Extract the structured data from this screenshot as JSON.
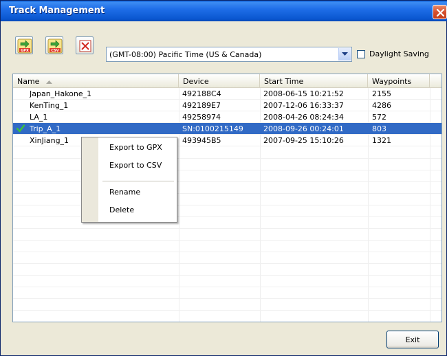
{
  "window": {
    "title": "Track Management",
    "close_icon": "close-icon"
  },
  "toolbar": {
    "export_gpx_label": "GPX",
    "export_csv_label": "CSV",
    "delete_icon": "delete-x-icon"
  },
  "timezone": {
    "selected": "(GMT-08:00) Pacific Time (US & Canada)"
  },
  "daylight_saving": {
    "label": "Daylight Saving",
    "checked": false
  },
  "list": {
    "columns": [
      "Name",
      "Device",
      "Start Time",
      "Waypoints"
    ],
    "sort_column": "Name",
    "sort_direction": "ascending",
    "rows": [
      {
        "name": "Japan_Hakone_1",
        "device": "492188C4",
        "start_time": "2008-06-15 10:21:52",
        "waypoints": "2155",
        "checked": false,
        "selected": false
      },
      {
        "name": "KenTing_1",
        "device": "492189E7",
        "start_time": "2007-12-06 16:33:37",
        "waypoints": "4286",
        "checked": false,
        "selected": false
      },
      {
        "name": "LA_1",
        "device": "49258974",
        "start_time": "2008-04-26 08:24:34",
        "waypoints": "572",
        "checked": false,
        "selected": false
      },
      {
        "name": "Trip_A_1",
        "device": "SN:0100215149",
        "start_time": "2008-09-26 00:24:01",
        "waypoints": "803",
        "checked": true,
        "selected": true
      },
      {
        "name": "XinJiang_1",
        "device": "493945B5",
        "start_time": "2007-09-25 15:10:26",
        "waypoints": "1321",
        "checked": false,
        "selected": false
      }
    ]
  },
  "context_menu": {
    "items": [
      "Export to GPX",
      "Export to CSV",
      "Rename",
      "Delete"
    ]
  },
  "footer": {
    "exit_label": "Exit"
  },
  "colors": {
    "title_bar": "#0a57d0",
    "selection": "#316ac5",
    "check": "#2e8b2e"
  }
}
